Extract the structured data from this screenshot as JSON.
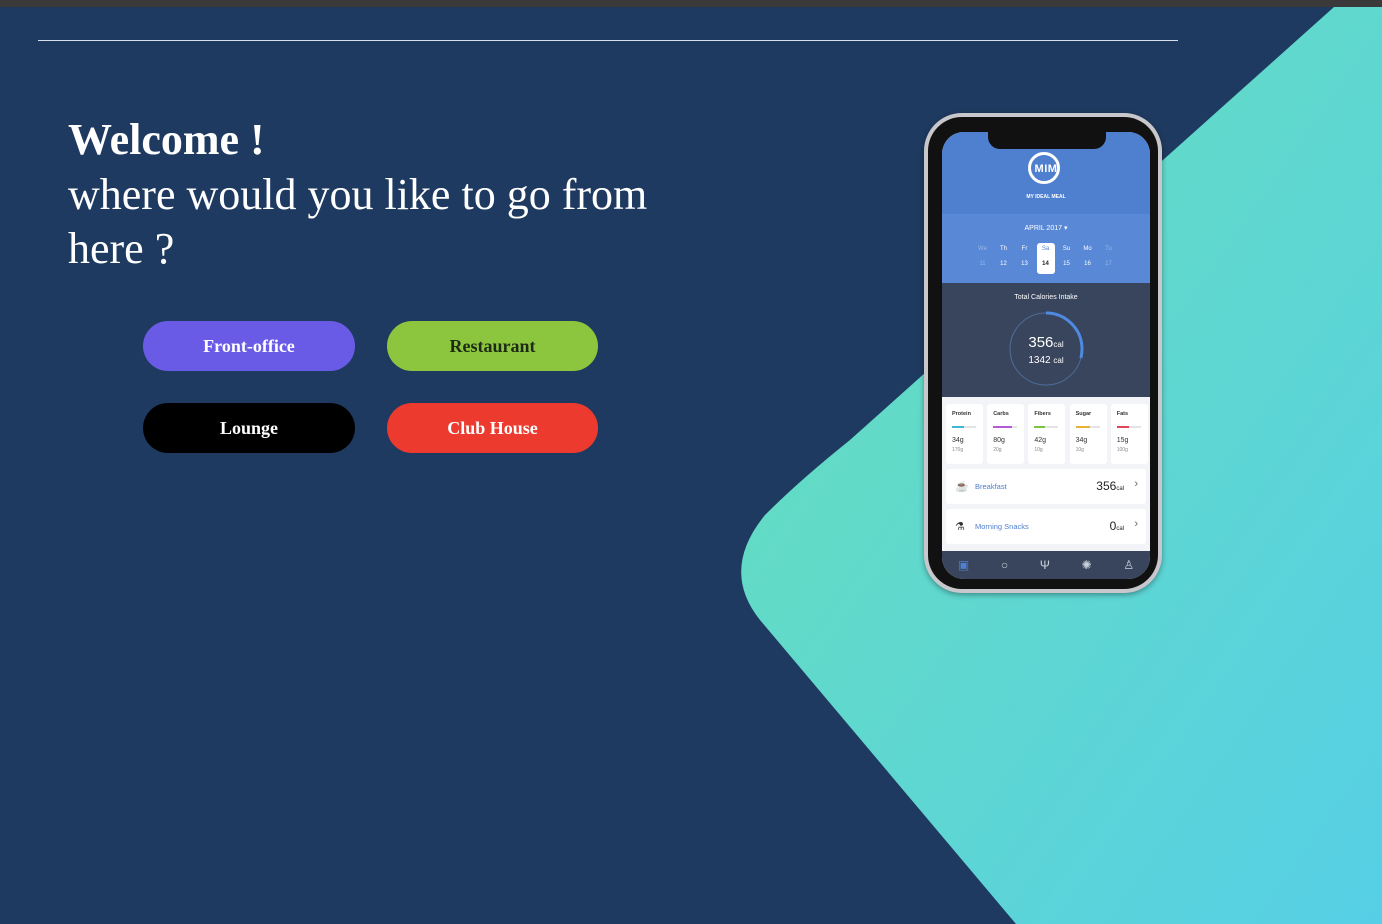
{
  "hero": {
    "title": "Welcome !",
    "subtitle": "where would you like to go from here ?"
  },
  "buttons": {
    "front_office": "Front-office",
    "restaurant": "Restaurant",
    "lounge": "Lounge",
    "club_house": "Club House"
  },
  "colors": {
    "background": "#1f3a60",
    "front_office": "#6a5be6",
    "restaurant": "#8cc63e",
    "lounge": "#000000",
    "club_house": "#ec3a2e",
    "accent_gradient_start": "#68e0b8",
    "accent_gradient_end": "#56cfe6"
  },
  "phone": {
    "logo_mark": "MIM",
    "logo_name": "MY IDEAL MEAL",
    "month": "APRIL 2017 ▾",
    "days": [
      {
        "d": "We",
        "n": "11"
      },
      {
        "d": "Th",
        "n": "12"
      },
      {
        "d": "Fr",
        "n": "13"
      },
      {
        "d": "Sa",
        "n": "14"
      },
      {
        "d": "Su",
        "n": "15"
      },
      {
        "d": "Mo",
        "n": "16"
      },
      {
        "d": "Tu",
        "n": "17"
      }
    ],
    "intake_title": "Total Calories Intake",
    "intake_value": "356",
    "intake_unit": "cal",
    "intake_goal": "1342",
    "intake_goal_unit": "cal",
    "intake_progress": 0.27,
    "macros": [
      {
        "name": "Protein",
        "value": "34g",
        "goal": "170g",
        "color": "#3fb8d8",
        "fill": 0.5
      },
      {
        "name": "Carbs",
        "value": "80g",
        "goal": "20g",
        "color": "#b35ad6",
        "fill": 0.8
      },
      {
        "name": "Fibers",
        "value": "42g",
        "goal": "10g",
        "color": "#7cc244",
        "fill": 0.45
      },
      {
        "name": "Sugar",
        "value": "34g",
        "goal": "10g",
        "color": "#e8b23a",
        "fill": 0.6
      },
      {
        "name": "Fats",
        "value": "15g",
        "goal": "100g",
        "color": "#e2455a",
        "fill": 0.5
      }
    ],
    "meals": [
      {
        "name": "Breakfast",
        "cal": "356",
        "unit": "cal",
        "icon": "breakfast-icon"
      },
      {
        "name": "Morning Snacks",
        "cal": "0",
        "unit": "cal",
        "icon": "snack-icon"
      }
    ],
    "tabs": [
      "journal-icon",
      "search-icon",
      "utensils-icon",
      "lightbulb-icon",
      "profile-icon"
    ]
  }
}
